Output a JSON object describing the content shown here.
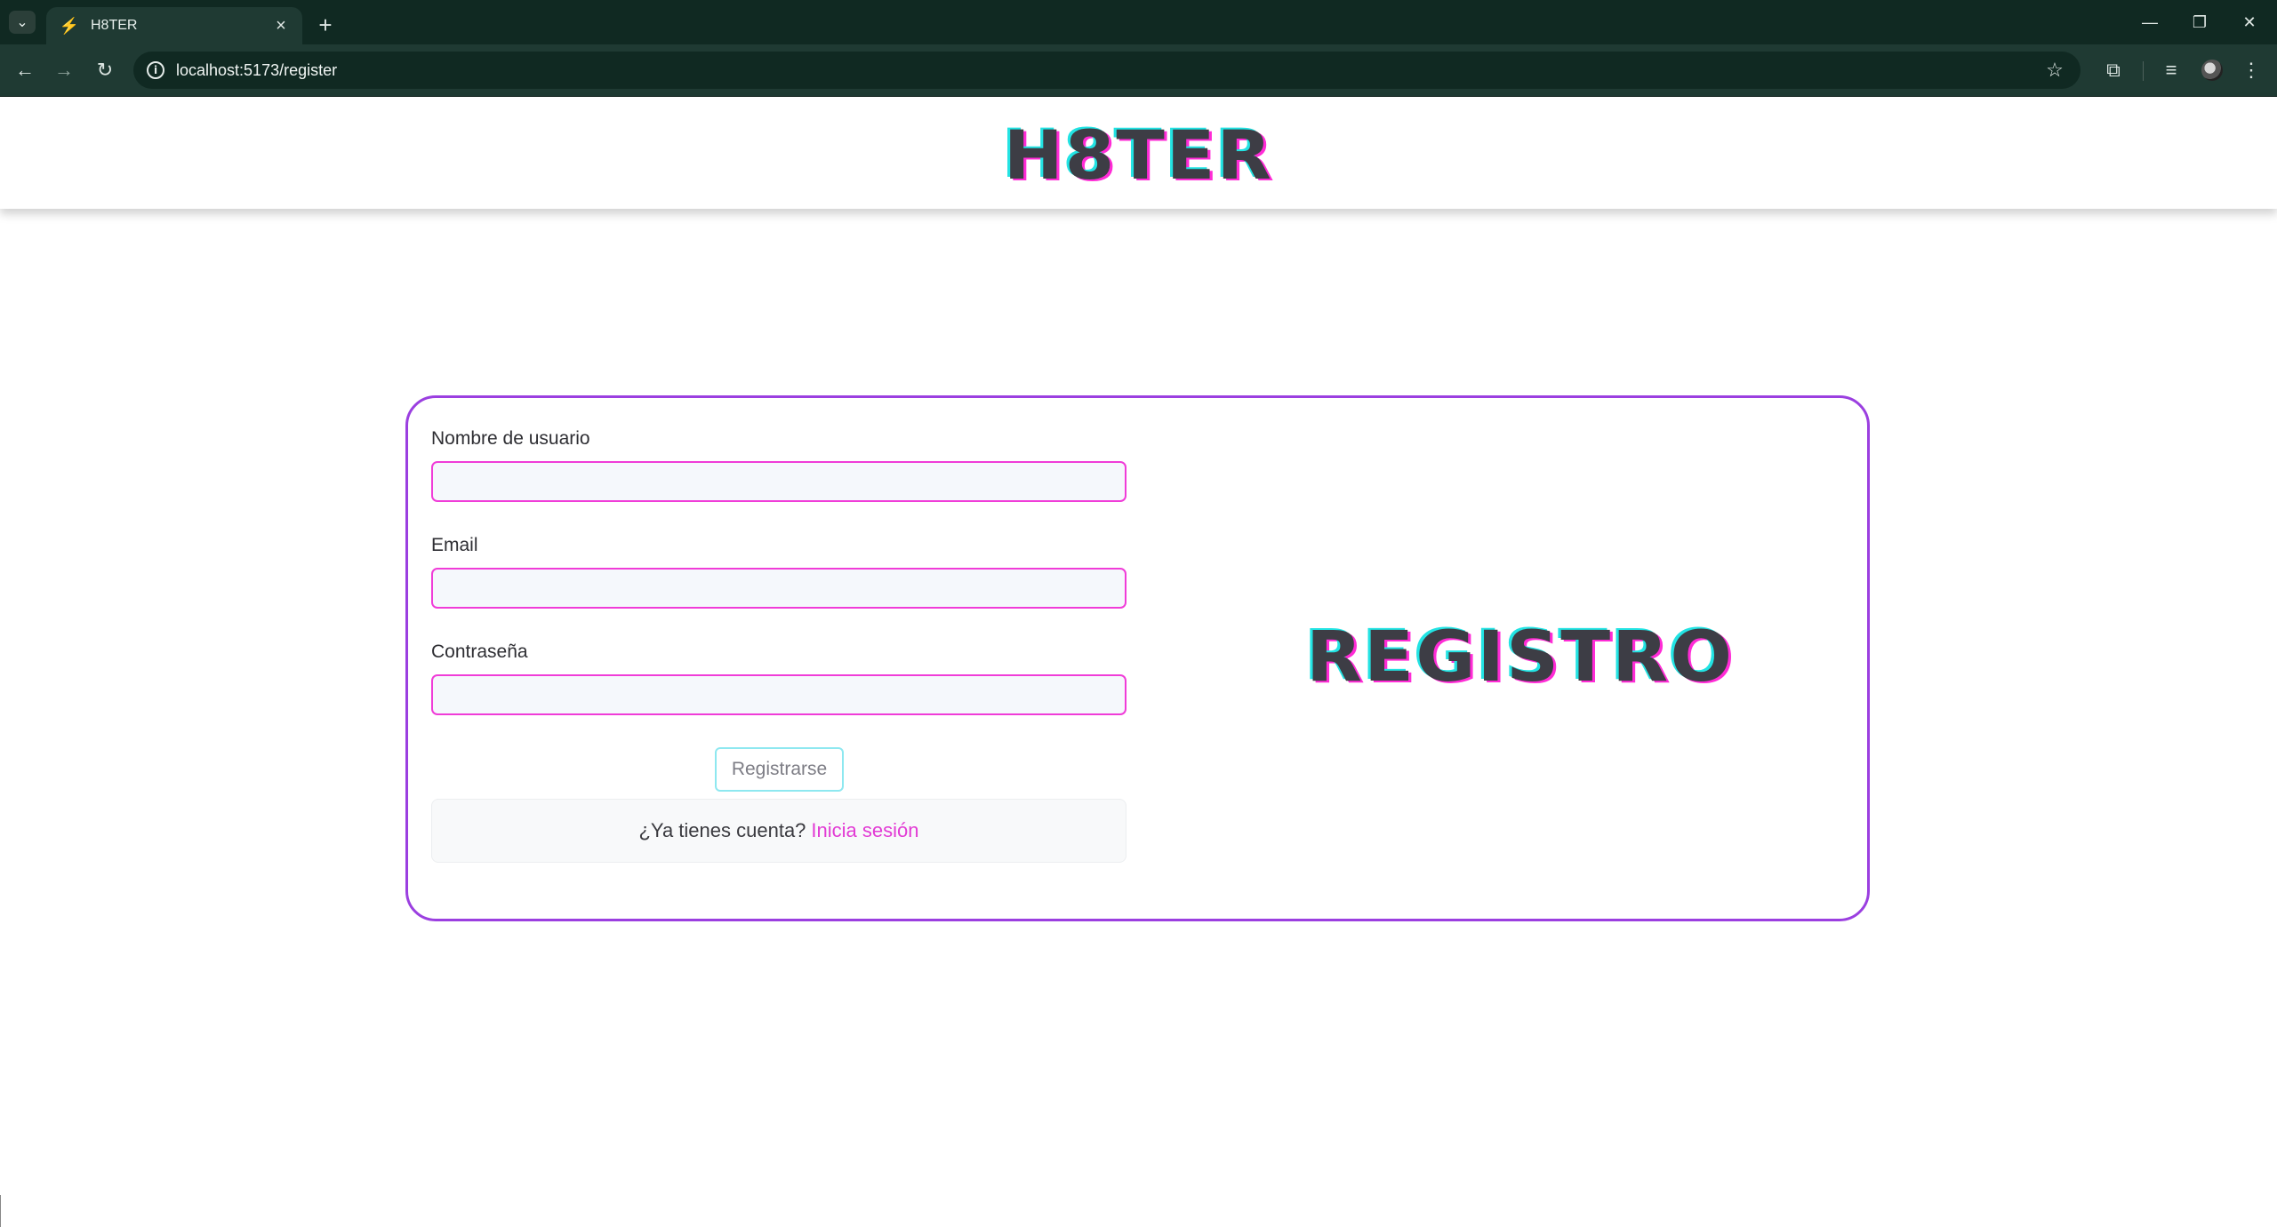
{
  "browser": {
    "tab_title": "H8TER",
    "url": "localhost:5173/register",
    "icons": [
      "tab-search-icon",
      "bolt-icon",
      "close-icon",
      "plus-icon",
      "minimize-icon",
      "restore-icon",
      "window-close-icon",
      "back-icon",
      "forward-icon",
      "reload-icon",
      "info-icon",
      "star-icon",
      "extensions-icon",
      "media-icon",
      "profile-icon",
      "menu-icon"
    ]
  },
  "header": {
    "brand": "H8TER"
  },
  "form": {
    "username_label": "Nombre de usuario",
    "username_value": "",
    "email_label": "Email",
    "email_value": "",
    "password_label": "Contraseña",
    "password_value": "",
    "submit_label": "Registrarse",
    "login_prompt": "¿Ya tienes cuenta?",
    "login_link": "Inicia sesión"
  },
  "panel": {
    "title": "REGISTRO"
  },
  "colors": {
    "accent_border": "#9b3fe0",
    "input_border": "#f03cd8",
    "button_border": "#8ee8f0",
    "link": "#e23bd4",
    "title_shadow_cyan": "#22e3e3",
    "title_shadow_magenta": "#ff2bd6",
    "chrome_dark": "#102922"
  }
}
